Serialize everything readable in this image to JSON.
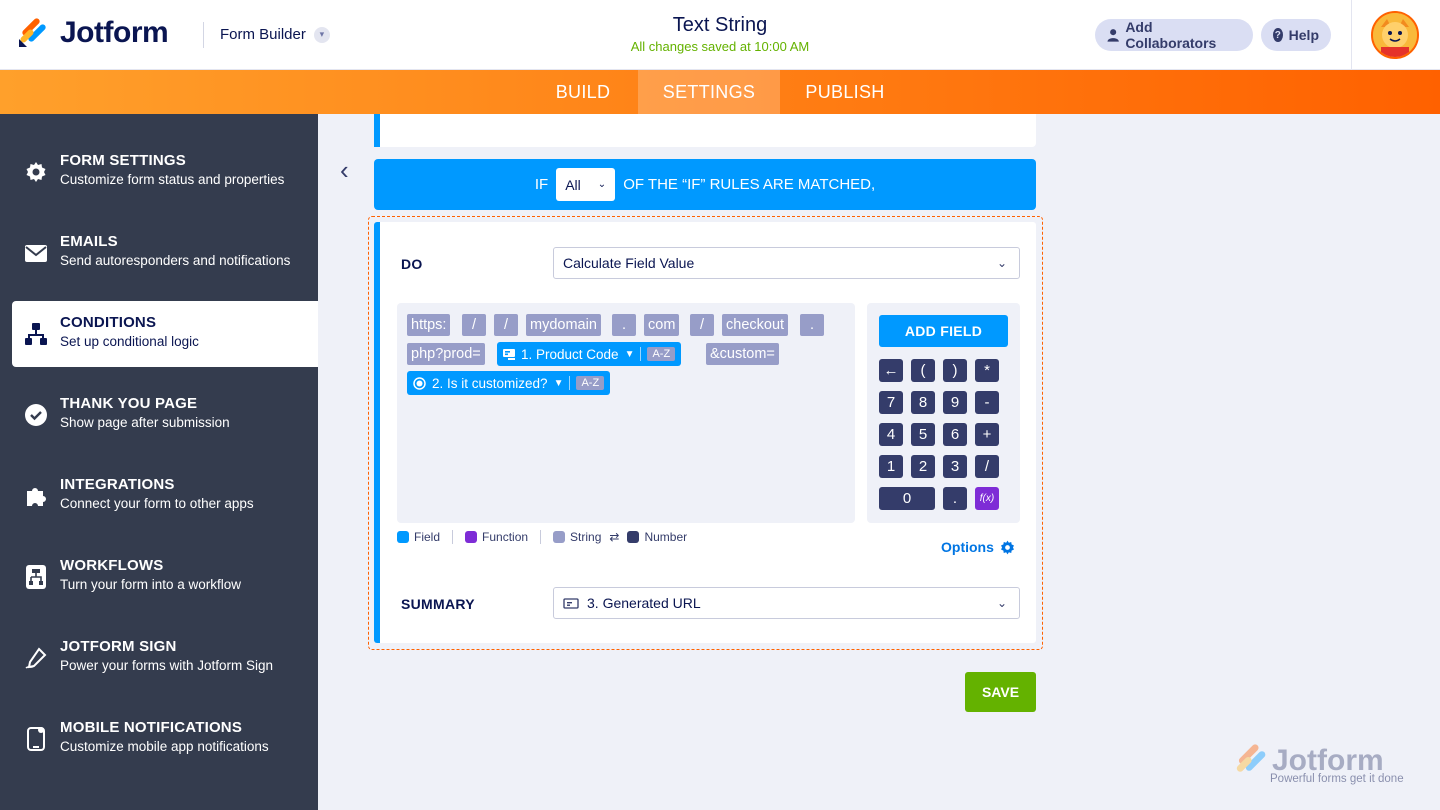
{
  "header": {
    "brand": "Jotform",
    "form_builder": "Form Builder",
    "title": "Text String",
    "saved_status": "All changes saved at 10:00 AM",
    "add_collaborators": "Add Collaborators",
    "help": "Help"
  },
  "tabs": [
    "BUILD",
    "SETTINGS",
    "PUBLISH"
  ],
  "sidebar": {
    "items": [
      {
        "title": "FORM SETTINGS",
        "subtitle": "Customize form status and properties",
        "icon": "gear-icon"
      },
      {
        "title": "EMAILS",
        "subtitle": "Send autoresponders and notifications",
        "icon": "envelope-icon"
      },
      {
        "title": "CONDITIONS",
        "subtitle": "Set up conditional logic",
        "icon": "conditions-icon"
      },
      {
        "title": "THANK YOU PAGE",
        "subtitle": "Show page after submission",
        "icon": "check-circle-icon"
      },
      {
        "title": "INTEGRATIONS",
        "subtitle": "Connect your form to other apps",
        "icon": "puzzle-icon"
      },
      {
        "title": "WORKFLOWS",
        "subtitle": "Turn your form into a workflow",
        "icon": "workflow-icon"
      },
      {
        "title": "JOTFORM SIGN",
        "subtitle": "Power your forms with Jotform Sign",
        "icon": "pen-icon"
      },
      {
        "title": "MOBILE NOTIFICATIONS",
        "subtitle": "Customize mobile app notifications",
        "icon": "phone-icon"
      }
    ]
  },
  "condition": {
    "if_prefix": "IF",
    "if_match": "All",
    "if_suffix": "OF THE “IF” RULES ARE MATCHED,",
    "do_label": "DO",
    "do_value": "Calculate Field Value",
    "tokens_row1": [
      "https:",
      "/",
      "/",
      "mydomain",
      ".",
      "com",
      "/",
      "checkout",
      "."
    ],
    "tokens_row2_string": "php?prod=",
    "field1": "1. Product Code",
    "field_badge": "A-Z",
    "tokens_row2_tail": "&custom=",
    "field2": "2. Is it customized?",
    "add_field": "ADD FIELD",
    "keys": [
      "←",
      "(",
      ")",
      "*",
      "7",
      "8",
      "9",
      "-",
      "4",
      "5",
      "6",
      "+",
      "1",
      "2",
      "3",
      "/",
      "0",
      ".",
      "f(x)"
    ],
    "legend": {
      "field": "Field",
      "function": "Function",
      "string": "String",
      "swap": "⇄",
      "number": "Number"
    },
    "options": "Options",
    "summary_label": "SUMMARY",
    "summary_value": "3. Generated URL",
    "save": "SAVE"
  },
  "watermark": {
    "brand": "Jotform",
    "tagline": "Powerful forms get it done"
  },
  "colors": {
    "orange": "#ff6100",
    "blue": "#0099ff",
    "green": "#64b200",
    "navy": "#0a1551",
    "sidebar": "#343c4e",
    "purple": "#7e2cd6",
    "string": "#979dc8",
    "number": "#343c6a"
  }
}
